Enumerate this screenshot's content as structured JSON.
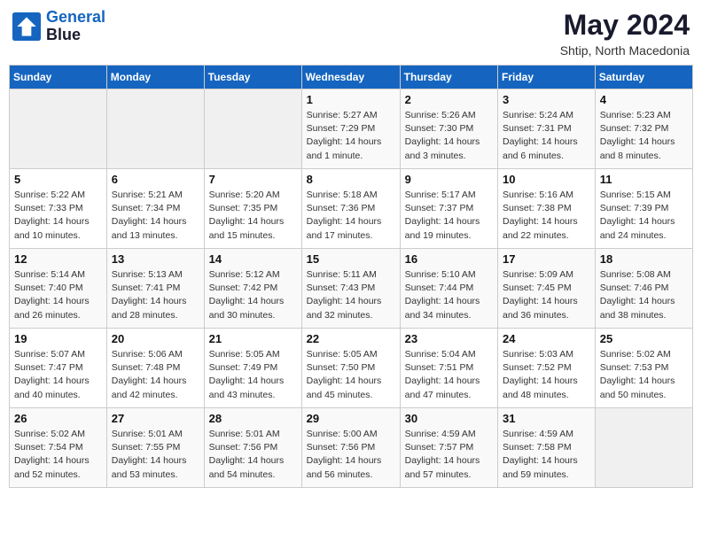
{
  "header": {
    "logo_line1": "General",
    "logo_line2": "Blue",
    "month": "May 2024",
    "location": "Shtip, North Macedonia"
  },
  "days_of_week": [
    "Sunday",
    "Monday",
    "Tuesday",
    "Wednesday",
    "Thursday",
    "Friday",
    "Saturday"
  ],
  "weeks": [
    [
      {
        "day": "",
        "sunrise": "",
        "sunset": "",
        "daylight": ""
      },
      {
        "day": "",
        "sunrise": "",
        "sunset": "",
        "daylight": ""
      },
      {
        "day": "",
        "sunrise": "",
        "sunset": "",
        "daylight": ""
      },
      {
        "day": "1",
        "sunrise": "Sunrise: 5:27 AM",
        "sunset": "Sunset: 7:29 PM",
        "daylight": "Daylight: 14 hours and 1 minute."
      },
      {
        "day": "2",
        "sunrise": "Sunrise: 5:26 AM",
        "sunset": "Sunset: 7:30 PM",
        "daylight": "Daylight: 14 hours and 3 minutes."
      },
      {
        "day": "3",
        "sunrise": "Sunrise: 5:24 AM",
        "sunset": "Sunset: 7:31 PM",
        "daylight": "Daylight: 14 hours and 6 minutes."
      },
      {
        "day": "4",
        "sunrise": "Sunrise: 5:23 AM",
        "sunset": "Sunset: 7:32 PM",
        "daylight": "Daylight: 14 hours and 8 minutes."
      }
    ],
    [
      {
        "day": "5",
        "sunrise": "Sunrise: 5:22 AM",
        "sunset": "Sunset: 7:33 PM",
        "daylight": "Daylight: 14 hours and 10 minutes."
      },
      {
        "day": "6",
        "sunrise": "Sunrise: 5:21 AM",
        "sunset": "Sunset: 7:34 PM",
        "daylight": "Daylight: 14 hours and 13 minutes."
      },
      {
        "day": "7",
        "sunrise": "Sunrise: 5:20 AM",
        "sunset": "Sunset: 7:35 PM",
        "daylight": "Daylight: 14 hours and 15 minutes."
      },
      {
        "day": "8",
        "sunrise": "Sunrise: 5:18 AM",
        "sunset": "Sunset: 7:36 PM",
        "daylight": "Daylight: 14 hours and 17 minutes."
      },
      {
        "day": "9",
        "sunrise": "Sunrise: 5:17 AM",
        "sunset": "Sunset: 7:37 PM",
        "daylight": "Daylight: 14 hours and 19 minutes."
      },
      {
        "day": "10",
        "sunrise": "Sunrise: 5:16 AM",
        "sunset": "Sunset: 7:38 PM",
        "daylight": "Daylight: 14 hours and 22 minutes."
      },
      {
        "day": "11",
        "sunrise": "Sunrise: 5:15 AM",
        "sunset": "Sunset: 7:39 PM",
        "daylight": "Daylight: 14 hours and 24 minutes."
      }
    ],
    [
      {
        "day": "12",
        "sunrise": "Sunrise: 5:14 AM",
        "sunset": "Sunset: 7:40 PM",
        "daylight": "Daylight: 14 hours and 26 minutes."
      },
      {
        "day": "13",
        "sunrise": "Sunrise: 5:13 AM",
        "sunset": "Sunset: 7:41 PM",
        "daylight": "Daylight: 14 hours and 28 minutes."
      },
      {
        "day": "14",
        "sunrise": "Sunrise: 5:12 AM",
        "sunset": "Sunset: 7:42 PM",
        "daylight": "Daylight: 14 hours and 30 minutes."
      },
      {
        "day": "15",
        "sunrise": "Sunrise: 5:11 AM",
        "sunset": "Sunset: 7:43 PM",
        "daylight": "Daylight: 14 hours and 32 minutes."
      },
      {
        "day": "16",
        "sunrise": "Sunrise: 5:10 AM",
        "sunset": "Sunset: 7:44 PM",
        "daylight": "Daylight: 14 hours and 34 minutes."
      },
      {
        "day": "17",
        "sunrise": "Sunrise: 5:09 AM",
        "sunset": "Sunset: 7:45 PM",
        "daylight": "Daylight: 14 hours and 36 minutes."
      },
      {
        "day": "18",
        "sunrise": "Sunrise: 5:08 AM",
        "sunset": "Sunset: 7:46 PM",
        "daylight": "Daylight: 14 hours and 38 minutes."
      }
    ],
    [
      {
        "day": "19",
        "sunrise": "Sunrise: 5:07 AM",
        "sunset": "Sunset: 7:47 PM",
        "daylight": "Daylight: 14 hours and 40 minutes."
      },
      {
        "day": "20",
        "sunrise": "Sunrise: 5:06 AM",
        "sunset": "Sunset: 7:48 PM",
        "daylight": "Daylight: 14 hours and 42 minutes."
      },
      {
        "day": "21",
        "sunrise": "Sunrise: 5:05 AM",
        "sunset": "Sunset: 7:49 PM",
        "daylight": "Daylight: 14 hours and 43 minutes."
      },
      {
        "day": "22",
        "sunrise": "Sunrise: 5:05 AM",
        "sunset": "Sunset: 7:50 PM",
        "daylight": "Daylight: 14 hours and 45 minutes."
      },
      {
        "day": "23",
        "sunrise": "Sunrise: 5:04 AM",
        "sunset": "Sunset: 7:51 PM",
        "daylight": "Daylight: 14 hours and 47 minutes."
      },
      {
        "day": "24",
        "sunrise": "Sunrise: 5:03 AM",
        "sunset": "Sunset: 7:52 PM",
        "daylight": "Daylight: 14 hours and 48 minutes."
      },
      {
        "day": "25",
        "sunrise": "Sunrise: 5:02 AM",
        "sunset": "Sunset: 7:53 PM",
        "daylight": "Daylight: 14 hours and 50 minutes."
      }
    ],
    [
      {
        "day": "26",
        "sunrise": "Sunrise: 5:02 AM",
        "sunset": "Sunset: 7:54 PM",
        "daylight": "Daylight: 14 hours and 52 minutes."
      },
      {
        "day": "27",
        "sunrise": "Sunrise: 5:01 AM",
        "sunset": "Sunset: 7:55 PM",
        "daylight": "Daylight: 14 hours and 53 minutes."
      },
      {
        "day": "28",
        "sunrise": "Sunrise: 5:01 AM",
        "sunset": "Sunset: 7:56 PM",
        "daylight": "Daylight: 14 hours and 54 minutes."
      },
      {
        "day": "29",
        "sunrise": "Sunrise: 5:00 AM",
        "sunset": "Sunset: 7:56 PM",
        "daylight": "Daylight: 14 hours and 56 minutes."
      },
      {
        "day": "30",
        "sunrise": "Sunrise: 4:59 AM",
        "sunset": "Sunset: 7:57 PM",
        "daylight": "Daylight: 14 hours and 57 minutes."
      },
      {
        "day": "31",
        "sunrise": "Sunrise: 4:59 AM",
        "sunset": "Sunset: 7:58 PM",
        "daylight": "Daylight: 14 hours and 59 minutes."
      },
      {
        "day": "",
        "sunrise": "",
        "sunset": "",
        "daylight": ""
      }
    ]
  ]
}
